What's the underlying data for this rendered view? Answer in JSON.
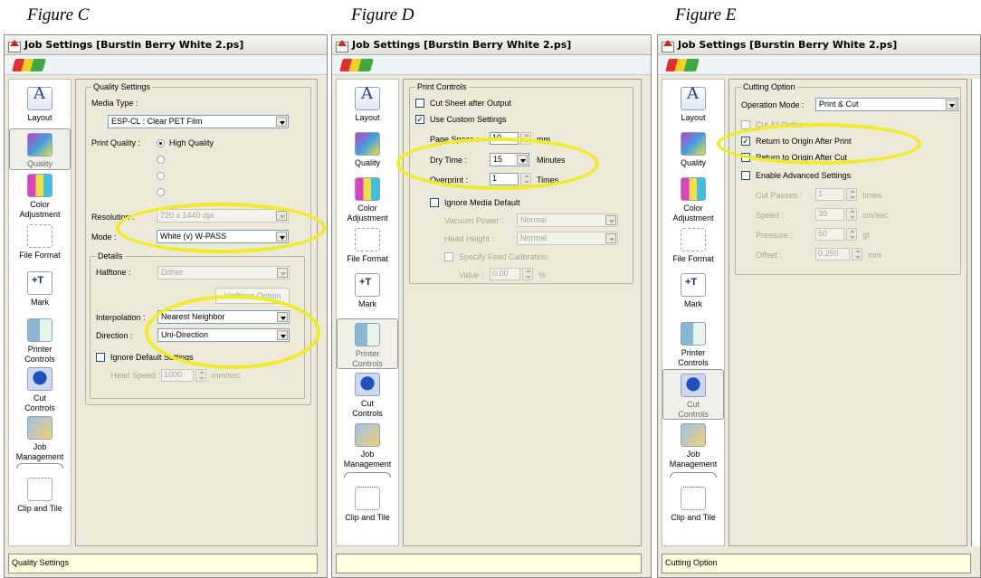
{
  "window_title": "Job Settings [Burstin Berry White 2.ps]",
  "sidebar": {
    "layout": "Layout",
    "quality": "Quality",
    "color1": "Color",
    "color2": "Adjustment",
    "file": "File Format",
    "mark": "Mark",
    "printer1": "Printer",
    "printer2": "Controls",
    "cut1": "Cut",
    "cut2": "Controls",
    "job1": "Job",
    "job2": "Management",
    "clip": "Clip and Tile"
  },
  "figC": {
    "label": "Figure C",
    "group": "Quality Settings",
    "media_type_label": "Media Type :",
    "media_type": "ESP-CL : Clear PET Film",
    "print_quality_label": "Print Quality :",
    "high_quality": "High Quality",
    "resolution_label": "Resolution :",
    "resolution": "720 x 1440 dpi",
    "mode_label": "Mode :",
    "mode": "White (v) W-PASS",
    "details": "Details",
    "halftone_label": "Halftone :",
    "halftone": "Dither",
    "halftone_option": "Halftone Option",
    "interpolation_label": "Interpolation :",
    "interpolation": "Nearest Neighbor",
    "direction_label": "Direction :",
    "direction": "Uni-Direction",
    "ignore_default": "Ignore Default Settings",
    "head_speed_label": "Head Speed :",
    "head_speed": "1000",
    "head_speed_unit": "mm/sec",
    "status": "Quality Settings"
  },
  "figD": {
    "label": "Figure D",
    "group": "Print Controls",
    "cut_sheet": "Cut Sheet after Output",
    "use_custom": "Use Custom Settings",
    "page_space_label": "Page Space :",
    "page_space": "10",
    "page_space_unit": "mm",
    "dry_time_label": "Dry Time :",
    "dry_time": "15",
    "dry_time_unit": "Minutes",
    "overprint_label": "Overprint :",
    "overprint": "1",
    "overprint_unit": "Times",
    "ignore_media": "Ignore Media Default",
    "vacuum_label": "Vacuum Power :",
    "vacuum": "Normal",
    "head_height_label": "Head Height :",
    "head_height": "Normal",
    "feed_cal": "Specify Feed Calibration",
    "value_label": "Value :",
    "value": "0.00",
    "value_unit": "%",
    "status": ""
  },
  "figE": {
    "label": "Figure E",
    "group": "Cutting Option",
    "op_mode_label": "Operation Mode :",
    "op_mode": "Print & Cut",
    "cut_all": "Cut All Paths",
    "return_after_print": "Return to Origin After Print",
    "return_after_cut": "Return to Origin After Cut",
    "enable_adv": "Enable Advanced Settings",
    "cut_passes_label": "Cut Passes :",
    "cut_passes": "1",
    "cut_passes_unit": "times",
    "speed_label": "Speed :",
    "speed": "30",
    "speed_unit": "cm/sec",
    "pressure_label": "Pressure :",
    "pressure": "50",
    "pressure_unit": "gf",
    "offset_label": "Offset :",
    "offset": "0.250",
    "offset_unit": "mm",
    "status": "Cutting Option"
  },
  "colors": {
    "highlight": "#f0ea28",
    "status_bg": "#ffffe0",
    "dialog_bg": "#ece9d8"
  }
}
